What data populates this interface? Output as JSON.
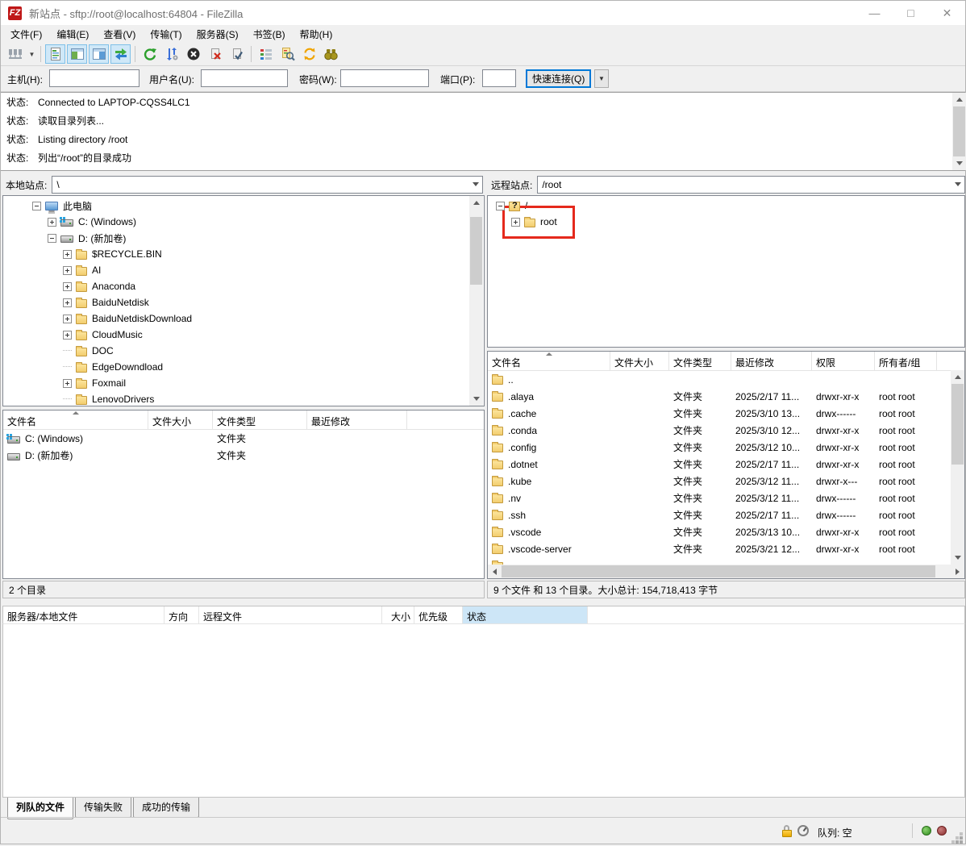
{
  "window": {
    "title": "新站点 - sftp://root@localhost:64804 - FileZilla",
    "app_logo": "FZ",
    "controls": {
      "minimize": "—",
      "maximize": "□",
      "close": "✕"
    }
  },
  "menu": {
    "items": [
      "文件(F)",
      "编辑(E)",
      "查看(V)",
      "传输(T)",
      "服务器(S)",
      "书签(B)",
      "帮助(H)"
    ]
  },
  "toolbar": {
    "buttons": [
      {
        "name": "site-manager-icon",
        "pressed": false,
        "dropdown": true
      },
      {
        "name": "separator"
      },
      {
        "name": "message-log-toggle-icon",
        "pressed": true
      },
      {
        "name": "local-tree-toggle-icon",
        "pressed": true
      },
      {
        "name": "remote-tree-toggle-icon",
        "pressed": true
      },
      {
        "name": "transfer-queue-toggle-icon",
        "pressed": true
      },
      {
        "name": "separator"
      },
      {
        "name": "refresh-icon",
        "pressed": false
      },
      {
        "name": "process-queue-icon",
        "pressed": false
      },
      {
        "name": "cancel-icon",
        "pressed": false
      },
      {
        "name": "disconnect-icon",
        "pressed": false
      },
      {
        "name": "reconnect-icon",
        "pressed": false
      },
      {
        "name": "separator"
      },
      {
        "name": "filter-icon",
        "pressed": false
      },
      {
        "name": "directory-comparison-icon",
        "pressed": false
      },
      {
        "name": "synchronized-browsing-icon",
        "pressed": false
      },
      {
        "name": "find-files-icon",
        "pressed": false
      }
    ]
  },
  "quickconnect": {
    "host_label": "主机(H):",
    "host_value": "",
    "username_label": "用户名(U):",
    "username_value": "",
    "password_label": "密码(W):",
    "password_value": "",
    "port_label": "端口(P):",
    "port_value": "",
    "button_label": "快速连接(Q)"
  },
  "log": {
    "entries": [
      {
        "label": "状态:",
        "message": "Connected to LAPTOP-CQSS4LC1"
      },
      {
        "label": "状态:",
        "message": "读取目录列表..."
      },
      {
        "label": "状态:",
        "message": "Listing directory /root"
      },
      {
        "label": "状态:",
        "message": "列出“/root”的目录成功"
      }
    ]
  },
  "local": {
    "site_label": "本地站点:",
    "site_value": "\\",
    "tree": [
      {
        "label": "此电脑",
        "level": 0,
        "expander": "minus",
        "icon": "computer"
      },
      {
        "label": "C: (Windows)",
        "level": 1,
        "expander": "plus",
        "icon": "drive-system"
      },
      {
        "label": "D: (新加卷)",
        "level": 1,
        "expander": "minus",
        "icon": "drive"
      },
      {
        "label": "$RECYCLE.BIN",
        "level": 2,
        "expander": "plus",
        "icon": "folder"
      },
      {
        "label": "AI",
        "level": 2,
        "expander": "plus",
        "icon": "folder"
      },
      {
        "label": "Anaconda",
        "level": 2,
        "expander": "plus",
        "icon": "folder"
      },
      {
        "label": "BaiduNetdisk",
        "level": 2,
        "expander": "plus",
        "icon": "folder"
      },
      {
        "label": "BaiduNetdiskDownload",
        "level": 2,
        "expander": "plus",
        "icon": "folder"
      },
      {
        "label": "CloudMusic",
        "level": 2,
        "expander": "plus",
        "icon": "folder"
      },
      {
        "label": "DOC",
        "level": 2,
        "expander": "none",
        "icon": "folder"
      },
      {
        "label": "EdgeDowndload",
        "level": 2,
        "expander": "none",
        "icon": "folder"
      },
      {
        "label": "Foxmail",
        "level": 2,
        "expander": "plus",
        "icon": "folder"
      },
      {
        "label": "LenovoDrivers",
        "level": 2,
        "expander": "none",
        "icon": "folder"
      }
    ],
    "columns": [
      "文件名",
      "文件大小",
      "文件类型",
      "最近修改"
    ],
    "rows": [
      {
        "name": "C: (Windows)",
        "icon": "drive-system",
        "size": "",
        "type": "文件夹",
        "modified": ""
      },
      {
        "name": "D: (新加卷)",
        "icon": "drive",
        "size": "",
        "type": "文件夹",
        "modified": ""
      }
    ],
    "status": "2 个目录"
  },
  "remote": {
    "site_label": "远程站点:",
    "site_value": "/root",
    "tree": [
      {
        "label": "/",
        "level": 0,
        "expander": "minus",
        "icon": "folder-unknown"
      },
      {
        "label": "root",
        "level": 1,
        "expander": "plus",
        "icon": "folder",
        "annotated": true
      }
    ],
    "columns": [
      "文件名",
      "文件大小",
      "文件类型",
      "最近修改",
      "权限",
      "所有者/组"
    ],
    "rows": [
      {
        "name": "..",
        "icon": "folder",
        "size": "",
        "type": "",
        "modified": "",
        "perms": "",
        "owner": ""
      },
      {
        "name": ".alaya",
        "icon": "folder",
        "size": "",
        "type": "文件夹",
        "modified": "2025/2/17 11...",
        "perms": "drwxr-xr-x",
        "owner": "root root"
      },
      {
        "name": ".cache",
        "icon": "folder",
        "size": "",
        "type": "文件夹",
        "modified": "2025/3/10 13...",
        "perms": "drwx------",
        "owner": "root root"
      },
      {
        "name": ".conda",
        "icon": "folder",
        "size": "",
        "type": "文件夹",
        "modified": "2025/3/10 12...",
        "perms": "drwxr-xr-x",
        "owner": "root root"
      },
      {
        "name": ".config",
        "icon": "folder",
        "size": "",
        "type": "文件夹",
        "modified": "2025/3/12 10...",
        "perms": "drwxr-xr-x",
        "owner": "root root"
      },
      {
        "name": ".dotnet",
        "icon": "folder",
        "size": "",
        "type": "文件夹",
        "modified": "2025/2/17 11...",
        "perms": "drwxr-xr-x",
        "owner": "root root"
      },
      {
        "name": ".kube",
        "icon": "folder",
        "size": "",
        "type": "文件夹",
        "modified": "2025/3/12 11...",
        "perms": "drwxr-x---",
        "owner": "root root"
      },
      {
        "name": ".nv",
        "icon": "folder",
        "size": "",
        "type": "文件夹",
        "modified": "2025/3/12 11...",
        "perms": "drwx------",
        "owner": "root root"
      },
      {
        "name": ".ssh",
        "icon": "folder",
        "size": "",
        "type": "文件夹",
        "modified": "2025/2/17 11...",
        "perms": "drwx------",
        "owner": "root root"
      },
      {
        "name": ".vscode",
        "icon": "folder",
        "size": "",
        "type": "文件夹",
        "modified": "2025/3/13 10...",
        "perms": "drwxr-xr-x",
        "owner": "root root"
      },
      {
        "name": ".vscode-server",
        "icon": "folder",
        "size": "",
        "type": "文件夹",
        "modified": "2025/3/21 12...",
        "perms": "drwxr-xr-x",
        "owner": "root root"
      },
      {
        "name": "",
        "icon": "folder",
        "size": "",
        "type": "",
        "modified": "",
        "perms": "",
        "owner": ""
      }
    ],
    "status": "9 个文件 和 13 个目录。大小总计: 154,718,413 字节"
  },
  "queue": {
    "columns": [
      "服务器/本地文件",
      "方向",
      "远程文件",
      "大小",
      "优先级",
      "状态"
    ],
    "tabs": [
      {
        "label": "列队的文件",
        "active": true
      },
      {
        "label": "传输失败",
        "active": false
      },
      {
        "label": "成功的传输",
        "active": false
      }
    ]
  },
  "statusbar": {
    "queue_label": "队列: 空"
  },
  "colors": {
    "annotation": "#e5291c",
    "header_selection": "#cde6f7",
    "pressed_button": "#cfe8f8"
  }
}
